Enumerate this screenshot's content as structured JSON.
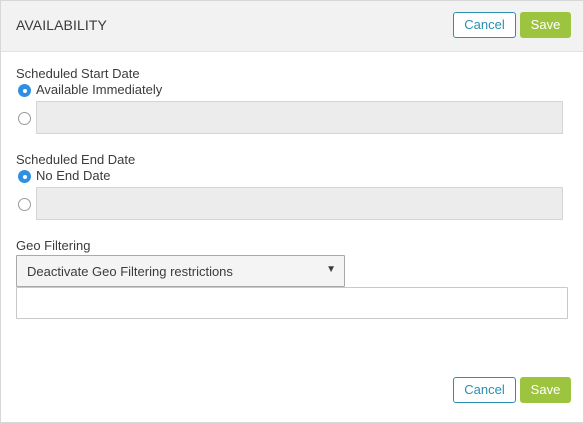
{
  "header": {
    "title": "AVAILABILITY",
    "cancel_label": "Cancel",
    "save_label": "Save"
  },
  "start_date": {
    "label": "Scheduled Start Date",
    "option_immediately": "Available Immediately",
    "selected": "immediately",
    "date_value": ""
  },
  "end_date": {
    "label": "Scheduled End Date",
    "option_no_end": "No End Date",
    "selected": "no_end",
    "date_value": ""
  },
  "geo": {
    "label": "Geo Filtering",
    "selected_option": "Deactivate Geo Filtering restrictions",
    "input_value": ""
  },
  "footer": {
    "cancel_label": "Cancel",
    "save_label": "Save"
  },
  "colors": {
    "accent_blue": "#2a8fb0",
    "save_green": "#9dc43f",
    "radio_blue": "#2f8fe0"
  }
}
